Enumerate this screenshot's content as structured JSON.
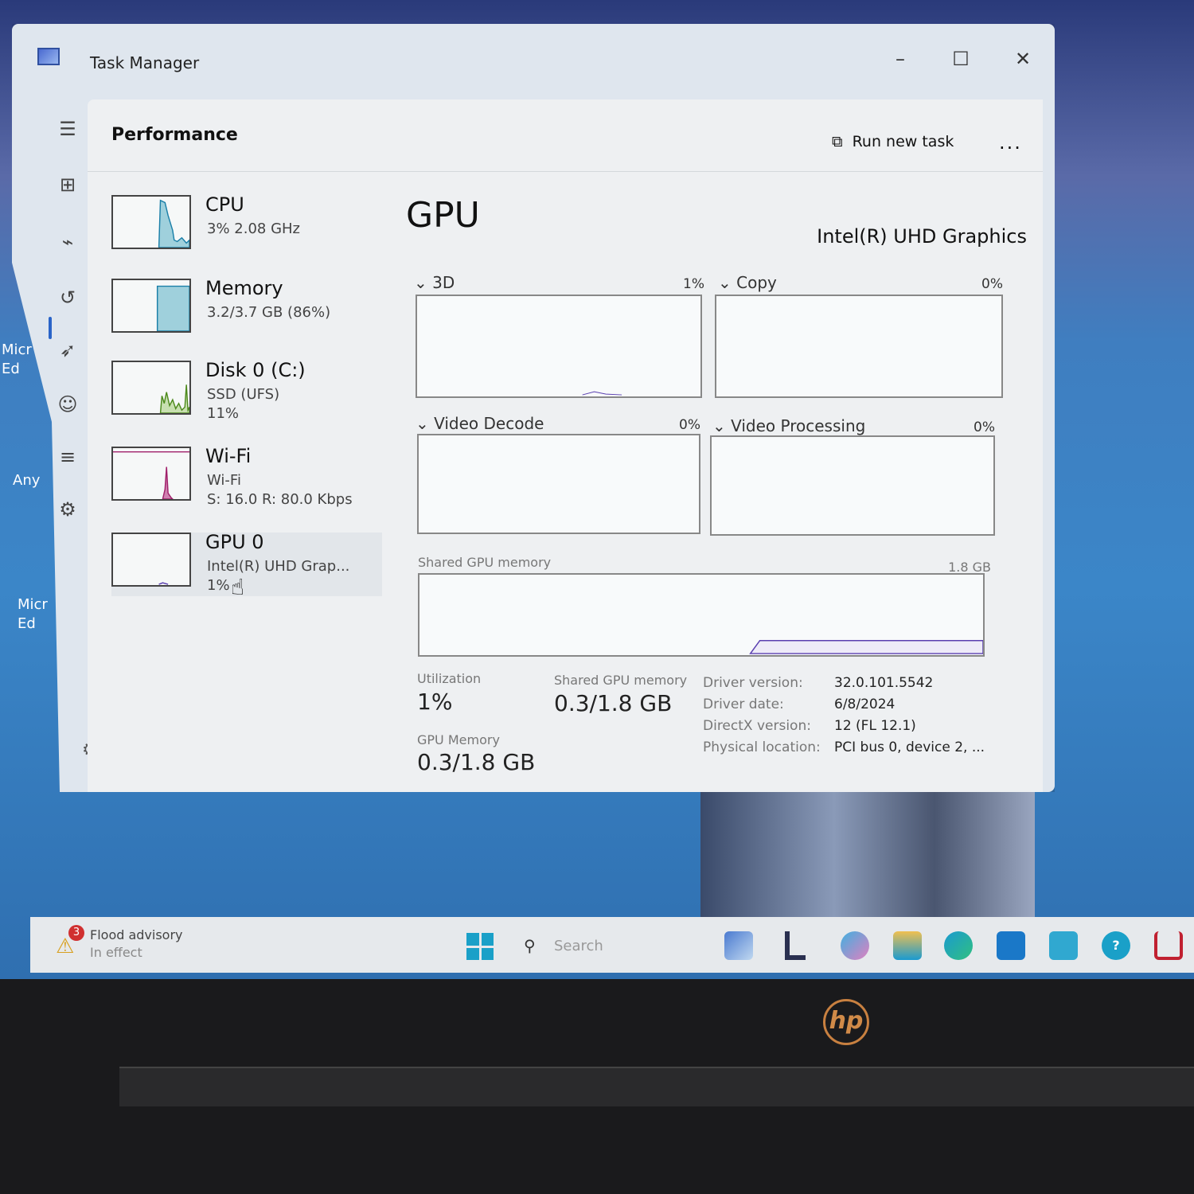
{
  "window": {
    "title": "Task Manager",
    "minimize": "–",
    "maximize": "☐",
    "close": "✕"
  },
  "header": {
    "title": "Performance",
    "run_new_task": "Run new task",
    "more": "..."
  },
  "sidebar": [
    {
      "name": "CPU",
      "sub1": "3% 2.08 GHz",
      "color": "#1a7fa8"
    },
    {
      "name": "Memory",
      "sub1": "3.2/3.7 GB (86%)",
      "color": "#1a7fa8"
    },
    {
      "name": "Disk 0 (C:)",
      "sub1": "SSD (UFS)",
      "sub2": "11%",
      "color": "#4d8a1c"
    },
    {
      "name": "Wi-Fi",
      "sub1": "Wi-Fi",
      "sub2": "S: 16.0 R: 80.0 Kbps",
      "color": "#a0206a"
    },
    {
      "name": "GPU 0",
      "sub1": "Intel(R) UHD Grap...",
      "sub2": "1%",
      "color": "#5a3fb0",
      "selected": true
    }
  ],
  "main": {
    "title": "GPU",
    "model": "Intel(R) UHD Graphics",
    "engines": [
      {
        "label": "3D",
        "pct": "1%"
      },
      {
        "label": "Copy",
        "pct": "0%"
      },
      {
        "label": "Video Decode",
        "pct": "0%"
      },
      {
        "label": "Video Processing",
        "pct": "0%"
      }
    ],
    "shared_label": "Shared GPU memory",
    "shared_max": "1.8 GB",
    "stats": {
      "utilization_label": "Utilization",
      "utilization": "1%",
      "shared_label": "Shared GPU memory",
      "shared": "0.3/1.8 GB",
      "gpu_mem_label": "GPU Memory",
      "gpu_mem": "0.3/1.8 GB"
    },
    "details": [
      {
        "k": "Driver version:",
        "v": "32.0.101.5542"
      },
      {
        "k": "Driver date:",
        "v": "6/8/2024"
      },
      {
        "k": "DirectX version:",
        "v": "12 (FL 12.1)"
      },
      {
        "k": "Physical location:",
        "v": "PCI bus 0, device 2, ..."
      }
    ]
  },
  "taskbar": {
    "weather_badge": "3",
    "weather_title": "Flood advisory",
    "weather_sub": "In effect",
    "search_placeholder": "Search"
  },
  "desktop": {
    "icons": [
      "Micr Ed",
      "Any",
      "Micr Ed"
    ]
  },
  "bezel": {
    "logo": "hp"
  }
}
